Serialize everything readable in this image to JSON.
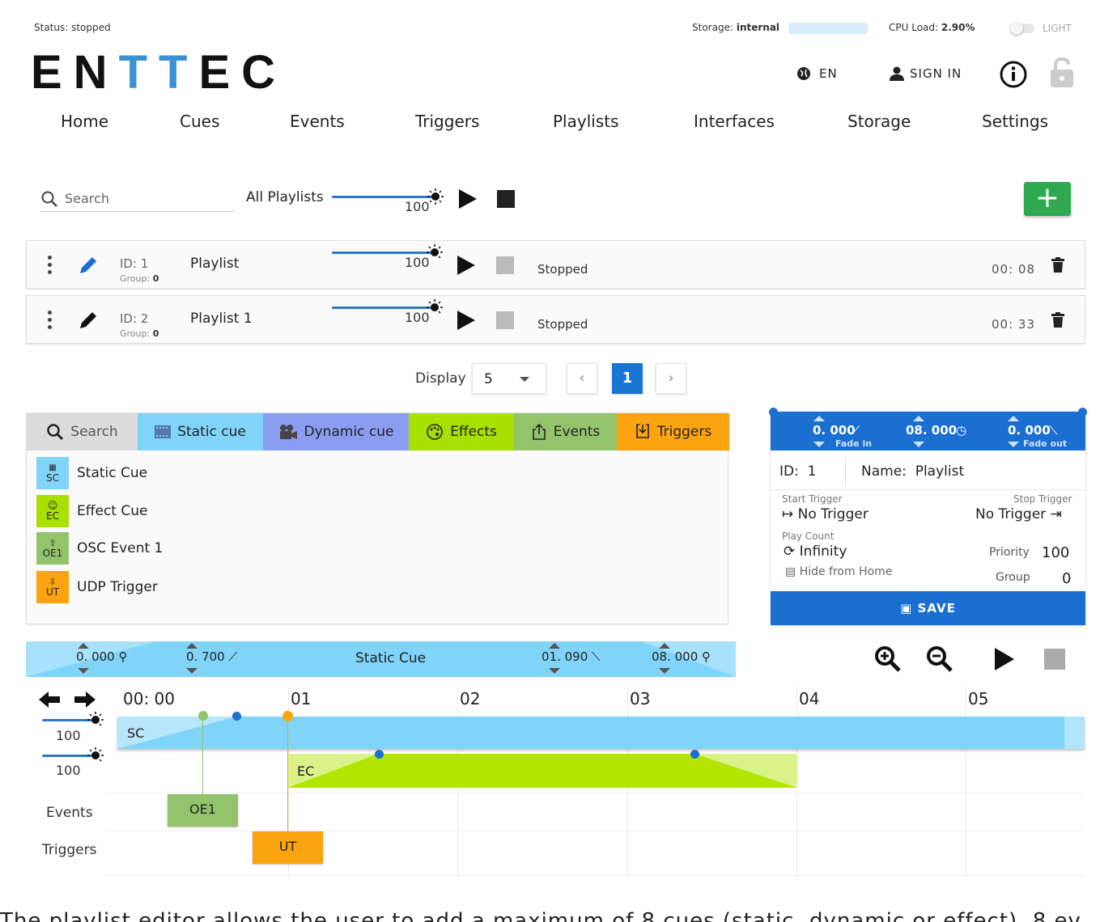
{
  "topbar": {
    "status": "Status: stopped",
    "storage_label": "Storage:",
    "storage_value": "internal",
    "cpu_label": "CPU Load:",
    "cpu_value": "2.90%",
    "theme_label": "LIGHT"
  },
  "logo": {
    "p1": "EN",
    "p2": "TT",
    "p3": "EC"
  },
  "header": {
    "lang": "EN",
    "signin": "SIGN IN"
  },
  "nav": [
    "Home",
    "Cues",
    "Events",
    "Triggers",
    "Playlists",
    "Interfaces",
    "Storage",
    "Settings"
  ],
  "playlists": {
    "search_placeholder": "Search",
    "all_label": "All Playlists",
    "all_level": "100",
    "rows": [
      {
        "id": "ID: 1",
        "group_label": "Group:",
        "group": "0",
        "name": "Playlist",
        "level": "100",
        "status": "Stopped",
        "duration": "00: 08"
      },
      {
        "id": "ID: 2",
        "group_label": "Group:",
        "group": "0",
        "name": "Playlist 1",
        "level": "100",
        "status": "Stopped",
        "duration": "00: 33"
      }
    ],
    "display_label": "Display",
    "display_value": "5",
    "page": "1"
  },
  "library": {
    "search": "Search",
    "tabs": [
      "Static cue",
      "Dynamic cue",
      "Effects",
      "Events",
      "Triggers"
    ],
    "items": [
      {
        "abbr": "SC",
        "name": "Static Cue"
      },
      {
        "abbr": "EC",
        "name": "Effect Cue"
      },
      {
        "abbr": "OE1",
        "name": "OSC Event 1"
      },
      {
        "abbr": "UT",
        "name": "UDP Trigger"
      }
    ]
  },
  "detail": {
    "fade_in": "0. 000",
    "fade_in_label": "Fade in",
    "duration": "08. 000",
    "fade_out": "0. 000",
    "fade_out_label": "Fade out",
    "id_label": "ID:",
    "id": "1",
    "name_label": "Name:",
    "name": "Playlist",
    "start_trigger_label": "Start Trigger",
    "start_trigger": "No Trigger",
    "stop_trigger_label": "Stop Trigger",
    "stop_trigger": "No Trigger",
    "play_count_label": "Play Count",
    "play_count": "Infinity",
    "priority_label": "Priority",
    "priority": "100",
    "hide_label": "Hide from Home",
    "group_label": "Group",
    "group": "0",
    "save": "SAVE"
  },
  "cuebar": {
    "v1": "0. 000",
    "v2": "0. 700",
    "name": "Static Cue",
    "v3": "01. 090",
    "v4": "08. 000"
  },
  "timeline": {
    "ticks": [
      "00: 00",
      "01",
      "02",
      "03",
      "04",
      "05"
    ],
    "level1": "100",
    "level2": "100",
    "sc": "SC",
    "ec": "EC",
    "events_label": "Events",
    "triggers_label": "Triggers",
    "event_box": "OE1",
    "trigger_box": "UT"
  },
  "colors": {
    "accent": "#1b6fd1",
    "static": "#80d4f8",
    "dynamic": "#8a9df0",
    "effects": "#a8e100",
    "events": "#93c46c",
    "triggers": "#fba40f",
    "add": "#2fa84f"
  },
  "caption": "The playlist editor allows the user to add a maximum of 8 cues (static, dynamic or effect), 8 ev"
}
